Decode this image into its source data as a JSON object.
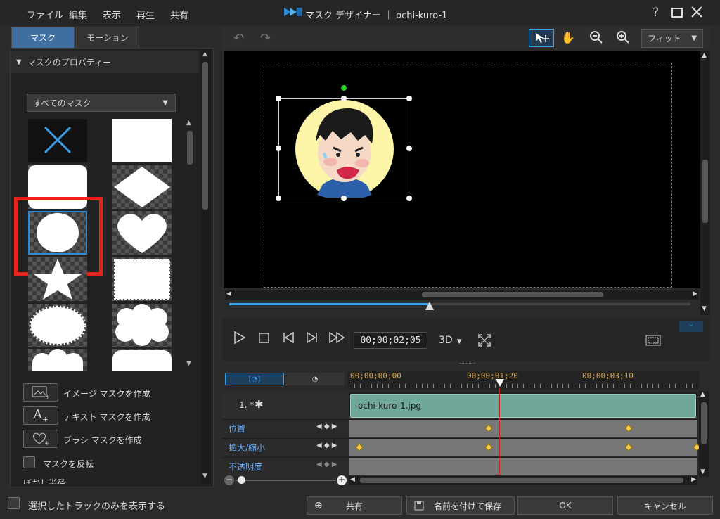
{
  "app": {
    "title": "マスク デザイナー ｜ ochi-kuro-1"
  },
  "menu": [
    "ファイル",
    "編集",
    "表示",
    "再生",
    "共有"
  ],
  "window_controls": {
    "help": "?"
  },
  "tabs": {
    "mask": "マスク",
    "motion": "モーション"
  },
  "properties": {
    "header": "マスクのプロパティー",
    "filter_value": "すべてのマスク",
    "create_image": "イメージ マスクを作成",
    "create_text": "テキスト マスクを作成",
    "create_brush": "ブラシ マスクを作成",
    "invert_label": "マスクを反転",
    "blur_label": "ぼかし半径"
  },
  "shapes": [
    "none",
    "rectangle",
    "rounded-rectangle",
    "diamond",
    "circle",
    "heart",
    "star",
    "stamp",
    "burst",
    "cloud",
    "cloud-bottom",
    "rounded-bottom"
  ],
  "toolbar": {
    "fit": "フィット"
  },
  "player": {
    "timecode": "00;00;02;05",
    "mode_3d": "3D"
  },
  "timeline": {
    "ruler": [
      "00;00;00;00",
      "00;00;01;20",
      "00;00;03;10"
    ],
    "track_label": "1. *",
    "clip_name": "ochi-kuro-1.jpg",
    "rows": [
      "位置",
      "拡大/縮小",
      "不透明度"
    ]
  },
  "footer": {
    "only_selected": "選択したトラックのみを表示する",
    "share": "共有",
    "save_as": "名前を付けて保存",
    "ok": "OK",
    "cancel": "キャンセル"
  },
  "colors": {
    "accent": "#3aa0e8",
    "highlight": "#e8221b",
    "clip": "#6fa898",
    "keyframe": "#f2c94c"
  }
}
